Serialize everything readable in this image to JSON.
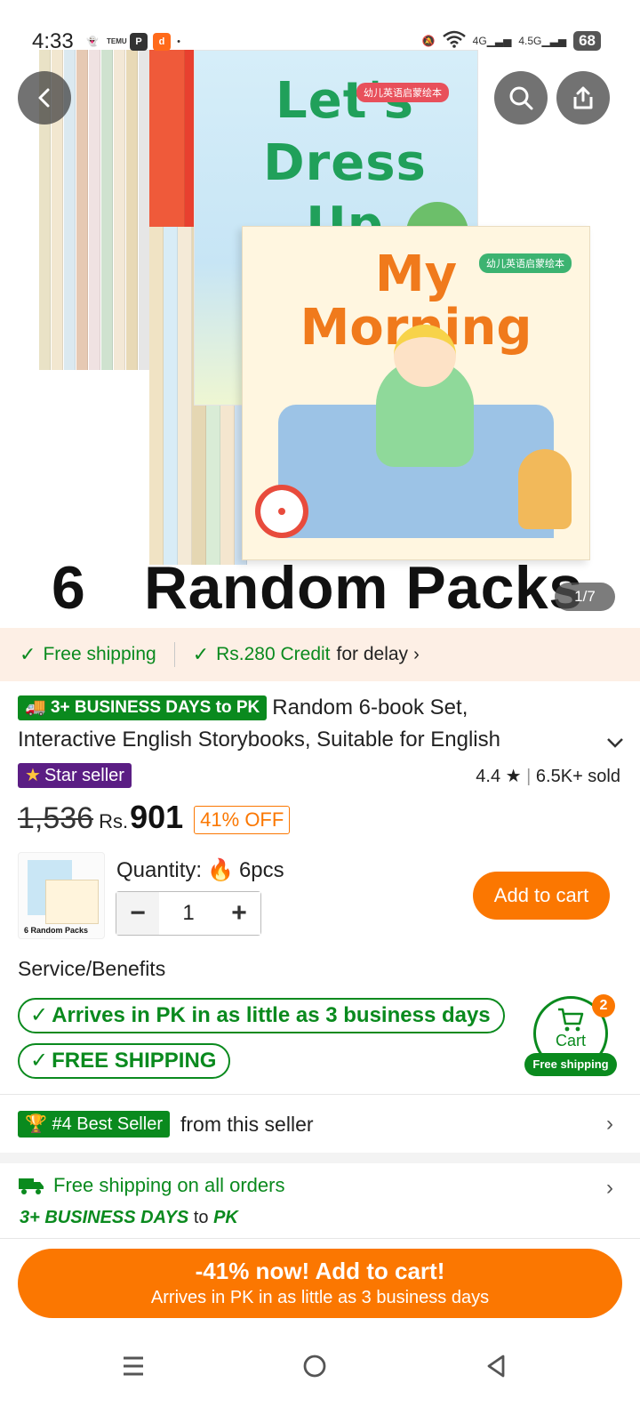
{
  "status_bar": {
    "time": "4:33",
    "notif_icons": [
      "snapchat-icon",
      "temu-icon",
      "pi-icon",
      "app-icon"
    ],
    "battery": "68"
  },
  "hero": {
    "cover_top_title": "Let's Dress Up",
    "cover_top_tag": "幼儿英语启蒙绘本",
    "cover_front_title": "My Morning",
    "cover_front_tag": "幼儿英语启蒙绘本",
    "caption_number": "6",
    "caption_text": "Random Packs",
    "image_counter": "1/7"
  },
  "shipping_strip": {
    "free_shipping": "Free shipping",
    "credit": "Rs.280 Credit",
    "credit_suffix": "for delay"
  },
  "product": {
    "delivery_badge": "3+ BUSINESS DAYS to PK",
    "title_line1": "Random 6-book Set,",
    "title_line2": "Interactive English Storybooks, Suitable for English",
    "star_seller": "Star seller",
    "rating": "4.4",
    "sold": "6.5K+ sold",
    "old_price": "1,536",
    "currency": "Rs.",
    "price": "901",
    "discount": "41% OFF"
  },
  "quantity": {
    "label": "Quantity:",
    "stock": "6pcs",
    "value": "1",
    "add_to_cart": "Add to cart",
    "thumb_caption": "6 Random Packs"
  },
  "service": {
    "title": "Service/Benefits",
    "pill_arrival": "Arrives in PK in as little as 3 business days",
    "pill_free": "FREE SHIPPING"
  },
  "cart_fab": {
    "label": "Cart",
    "count": "2",
    "free_label": "Free shipping"
  },
  "best_seller": {
    "badge": "#4 Best Seller",
    "text": "from this seller"
  },
  "free_all": {
    "text": "Free shipping on all orders",
    "days": "3+ BUSINESS DAYS",
    "to": "to",
    "dest": "PK"
  },
  "cta": {
    "line1": "-41% now! Add to cart!",
    "line2": "Arrives in PK in as little as 3 business days"
  },
  "colors": {
    "accent_orange": "#fb7701",
    "accent_green": "#0a8a1e",
    "star_purple": "#5b1e84",
    "strip_bg": "#fdefe5"
  }
}
